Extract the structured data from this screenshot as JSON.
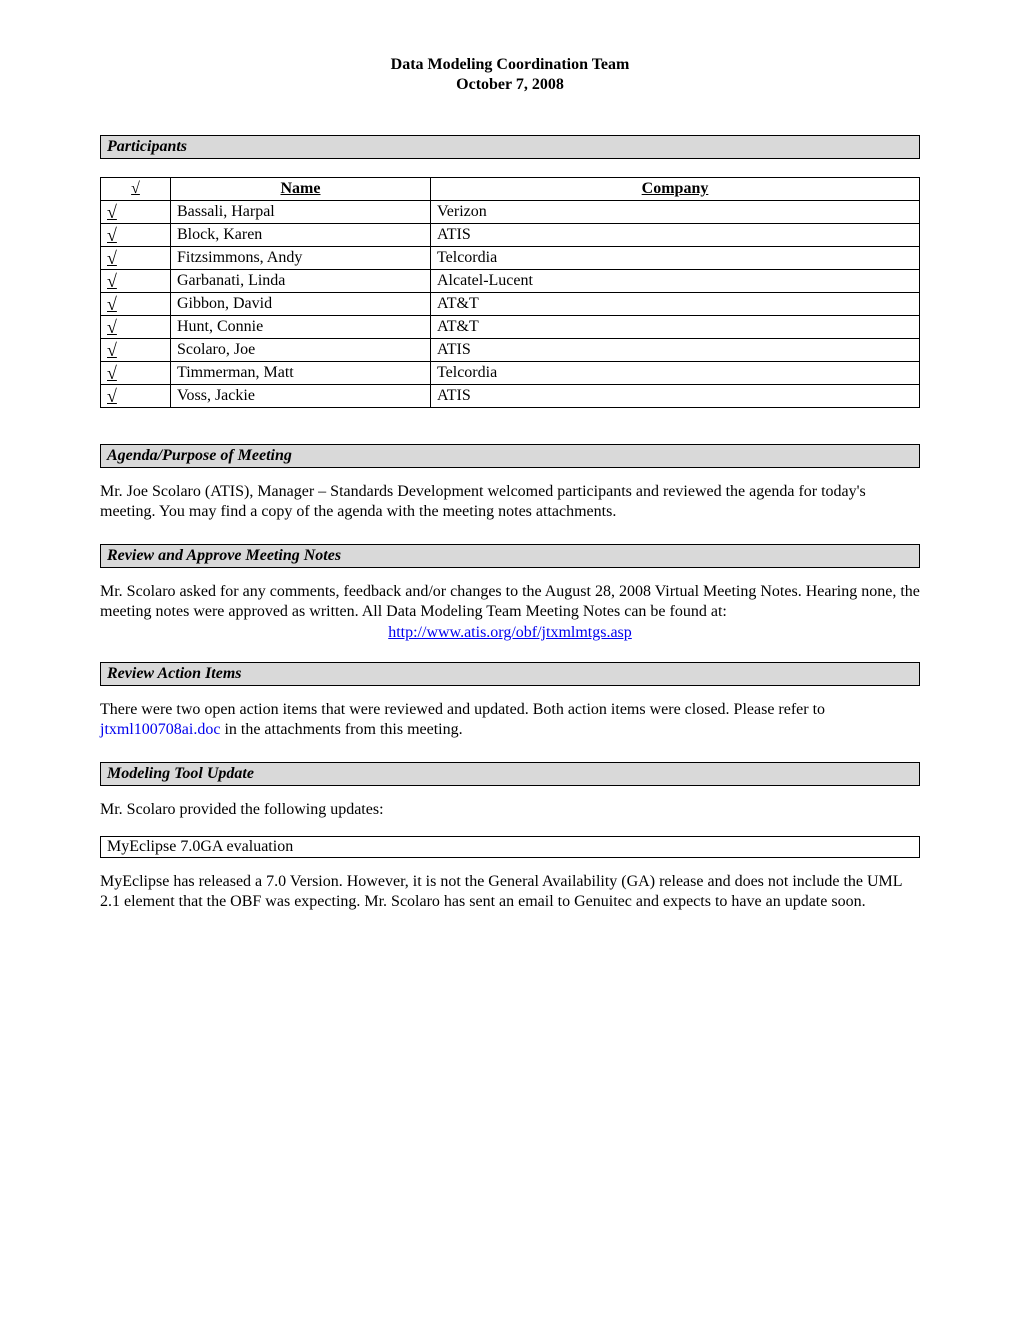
{
  "header": {
    "line1": "Data Modeling Coordination Team",
    "line2": "October 7, 2008"
  },
  "sections": {
    "participants_title": "Participants",
    "agenda_title": "Agenda/Purpose of Meeting",
    "review_notes_title": "Review and Approve Meeting Notes",
    "review_actions_title": "Review Action Items",
    "modeling_tool_title": "Modeling Tool Update",
    "myeclipse_subtitle": "MyEclipse 7.0GA evaluation"
  },
  "participants_table": {
    "check_header": "√",
    "name_header": "Name",
    "company_header": "Company",
    "rows": [
      {
        "check": "√",
        "name": "Bassali, Harpal",
        "company": "Verizon"
      },
      {
        "check": "√",
        "name": "Block, Karen",
        "company": "ATIS"
      },
      {
        "check": "√",
        "name": "Fitzsimmons, Andy",
        "company": "Telcordia"
      },
      {
        "check": "√",
        "name": "Garbanati, Linda",
        "company": "Alcatel-Lucent"
      },
      {
        "check": "√",
        "name": "Gibbon, David",
        "company": "AT&T"
      },
      {
        "check": "√",
        "name": "Hunt, Connie",
        "company": "AT&T"
      },
      {
        "check": "√",
        "name": "Scolaro, Joe",
        "company": "ATIS"
      },
      {
        "check": "√",
        "name": "Timmerman, Matt",
        "company": "Telcordia"
      },
      {
        "check": "√",
        "name": "Voss, Jackie",
        "company": "ATIS"
      }
    ]
  },
  "body": {
    "agenda_p": "Mr. Joe Scolaro (ATIS), Manager – Standards Development welcomed participants and reviewed the agenda for today's meeting. You may find a copy of the agenda with the meeting notes attachments.",
    "review_notes_p": "Mr. Scolaro asked for any comments, feedback and/or changes to the August 28, 2008 Virtual Meeting Notes. Hearing none, the meeting notes were approved as written. All Data Modeling Team Meeting Notes can be found at:",
    "review_notes_link": "http://www.atis.org/obf/jtxmlmtgs.asp",
    "review_actions_p1": "There were two open action items that were reviewed and updated. Both action items were closed. Please refer to ",
    "review_actions_file": "jtxml100708ai.doc",
    "review_actions_p2": " in the attachments from this meeting.",
    "modeling_intro": "Mr. Scolaro provided the following updates:",
    "myeclipse_p": "MyEclipse has released a 7.0 Version. However, it is not the General Availability (GA) release and does not include the UML 2.1 element that the OBF was expecting. Mr. Scolaro has sent an email to Genuitec and expects to have an update soon."
  }
}
